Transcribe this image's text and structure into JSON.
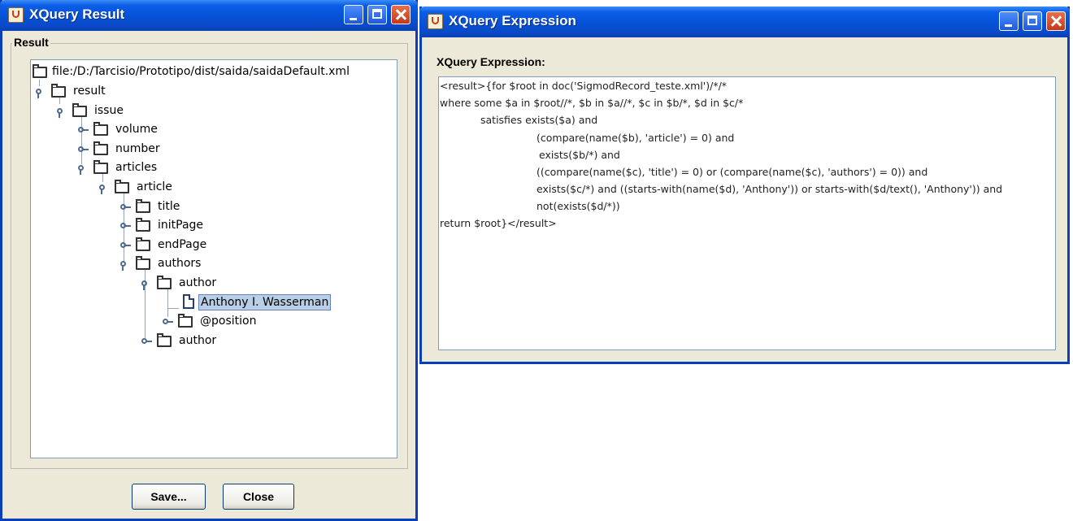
{
  "result_window": {
    "title": "XQuery Result",
    "group_label": "Result",
    "tree": {
      "root": "file:/D:/Tarcisio/Prototipo/dist/saida/saidaDefault.xml",
      "result": "result",
      "issue": "issue",
      "volume": "volume",
      "number": "number",
      "articles": "articles",
      "article": "article",
      "title": "title",
      "initPage": "initPage",
      "endPage": "endPage",
      "authors": "authors",
      "author1": "author",
      "author_text": "Anthony I. Wasserman",
      "position": "@position",
      "author2": "author"
    },
    "save_label": "Save...",
    "close_label": "Close"
  },
  "expression_window": {
    "title": "XQuery Expression",
    "label": "XQuery Expression:",
    "lines": [
      "<result>{for $root in doc('SigmodRecord_teste.xml')/*/*",
      "where some $a in $root//*, $b in $a//*, $c in $b/*, $d in $c/*",
      "satisfies exists($a) and",
      "(compare(name($b), 'article') = 0) and",
      "exists($b/*) and",
      "((compare(name($c), 'title') = 0) or (compare(name($c), 'authors') = 0)) and",
      "exists($c/*) and ((starts-with(name($d), 'Anthony')) or starts-with($d/text(), 'Anthony')) and",
      "not(exists($d/*))",
      "return $root}</result>"
    ]
  },
  "icons": [
    "java-icon",
    "minimize-icon",
    "maximize-icon",
    "close-icon",
    "folder-icon",
    "file-icon",
    "tree-handle-icon"
  ]
}
